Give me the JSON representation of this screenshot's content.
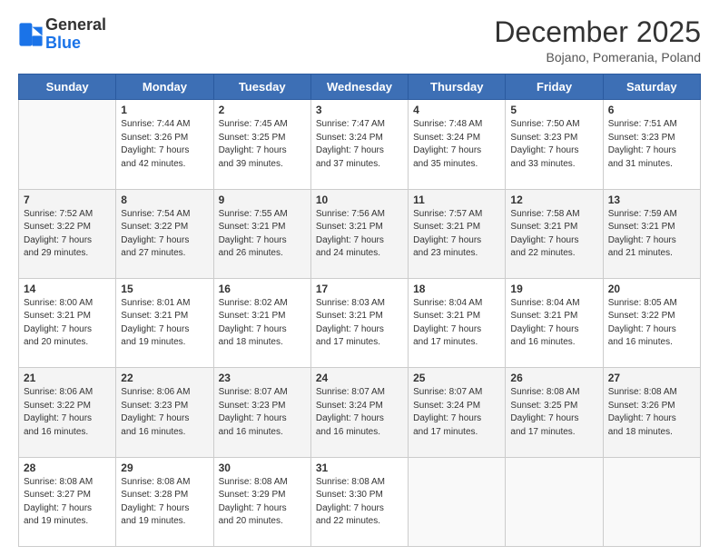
{
  "logo": {
    "line1": "General",
    "line2": "Blue"
  },
  "title": "December 2025",
  "subtitle": "Bojano, Pomerania, Poland",
  "days_header": [
    "Sunday",
    "Monday",
    "Tuesday",
    "Wednesday",
    "Thursday",
    "Friday",
    "Saturday"
  ],
  "weeks": [
    [
      {
        "day": "",
        "info": ""
      },
      {
        "day": "1",
        "info": "Sunrise: 7:44 AM\nSunset: 3:26 PM\nDaylight: 7 hours\nand 42 minutes."
      },
      {
        "day": "2",
        "info": "Sunrise: 7:45 AM\nSunset: 3:25 PM\nDaylight: 7 hours\nand 39 minutes."
      },
      {
        "day": "3",
        "info": "Sunrise: 7:47 AM\nSunset: 3:24 PM\nDaylight: 7 hours\nand 37 minutes."
      },
      {
        "day": "4",
        "info": "Sunrise: 7:48 AM\nSunset: 3:24 PM\nDaylight: 7 hours\nand 35 minutes."
      },
      {
        "day": "5",
        "info": "Sunrise: 7:50 AM\nSunset: 3:23 PM\nDaylight: 7 hours\nand 33 minutes."
      },
      {
        "day": "6",
        "info": "Sunrise: 7:51 AM\nSunset: 3:23 PM\nDaylight: 7 hours\nand 31 minutes."
      }
    ],
    [
      {
        "day": "7",
        "info": "Sunrise: 7:52 AM\nSunset: 3:22 PM\nDaylight: 7 hours\nand 29 minutes."
      },
      {
        "day": "8",
        "info": "Sunrise: 7:54 AM\nSunset: 3:22 PM\nDaylight: 7 hours\nand 27 minutes."
      },
      {
        "day": "9",
        "info": "Sunrise: 7:55 AM\nSunset: 3:21 PM\nDaylight: 7 hours\nand 26 minutes."
      },
      {
        "day": "10",
        "info": "Sunrise: 7:56 AM\nSunset: 3:21 PM\nDaylight: 7 hours\nand 24 minutes."
      },
      {
        "day": "11",
        "info": "Sunrise: 7:57 AM\nSunset: 3:21 PM\nDaylight: 7 hours\nand 23 minutes."
      },
      {
        "day": "12",
        "info": "Sunrise: 7:58 AM\nSunset: 3:21 PM\nDaylight: 7 hours\nand 22 minutes."
      },
      {
        "day": "13",
        "info": "Sunrise: 7:59 AM\nSunset: 3:21 PM\nDaylight: 7 hours\nand 21 minutes."
      }
    ],
    [
      {
        "day": "14",
        "info": "Sunrise: 8:00 AM\nSunset: 3:21 PM\nDaylight: 7 hours\nand 20 minutes."
      },
      {
        "day": "15",
        "info": "Sunrise: 8:01 AM\nSunset: 3:21 PM\nDaylight: 7 hours\nand 19 minutes."
      },
      {
        "day": "16",
        "info": "Sunrise: 8:02 AM\nSunset: 3:21 PM\nDaylight: 7 hours\nand 18 minutes."
      },
      {
        "day": "17",
        "info": "Sunrise: 8:03 AM\nSunset: 3:21 PM\nDaylight: 7 hours\nand 17 minutes."
      },
      {
        "day": "18",
        "info": "Sunrise: 8:04 AM\nSunset: 3:21 PM\nDaylight: 7 hours\nand 17 minutes."
      },
      {
        "day": "19",
        "info": "Sunrise: 8:04 AM\nSunset: 3:21 PM\nDaylight: 7 hours\nand 16 minutes."
      },
      {
        "day": "20",
        "info": "Sunrise: 8:05 AM\nSunset: 3:22 PM\nDaylight: 7 hours\nand 16 minutes."
      }
    ],
    [
      {
        "day": "21",
        "info": "Sunrise: 8:06 AM\nSunset: 3:22 PM\nDaylight: 7 hours\nand 16 minutes."
      },
      {
        "day": "22",
        "info": "Sunrise: 8:06 AM\nSunset: 3:23 PM\nDaylight: 7 hours\nand 16 minutes."
      },
      {
        "day": "23",
        "info": "Sunrise: 8:07 AM\nSunset: 3:23 PM\nDaylight: 7 hours\nand 16 minutes."
      },
      {
        "day": "24",
        "info": "Sunrise: 8:07 AM\nSunset: 3:24 PM\nDaylight: 7 hours\nand 16 minutes."
      },
      {
        "day": "25",
        "info": "Sunrise: 8:07 AM\nSunset: 3:24 PM\nDaylight: 7 hours\nand 17 minutes."
      },
      {
        "day": "26",
        "info": "Sunrise: 8:08 AM\nSunset: 3:25 PM\nDaylight: 7 hours\nand 17 minutes."
      },
      {
        "day": "27",
        "info": "Sunrise: 8:08 AM\nSunset: 3:26 PM\nDaylight: 7 hours\nand 18 minutes."
      }
    ],
    [
      {
        "day": "28",
        "info": "Sunrise: 8:08 AM\nSunset: 3:27 PM\nDaylight: 7 hours\nand 19 minutes."
      },
      {
        "day": "29",
        "info": "Sunrise: 8:08 AM\nSunset: 3:28 PM\nDaylight: 7 hours\nand 19 minutes."
      },
      {
        "day": "30",
        "info": "Sunrise: 8:08 AM\nSunset: 3:29 PM\nDaylight: 7 hours\nand 20 minutes."
      },
      {
        "day": "31",
        "info": "Sunrise: 8:08 AM\nSunset: 3:30 PM\nDaylight: 7 hours\nand 22 minutes."
      },
      {
        "day": "",
        "info": ""
      },
      {
        "day": "",
        "info": ""
      },
      {
        "day": "",
        "info": ""
      }
    ]
  ]
}
